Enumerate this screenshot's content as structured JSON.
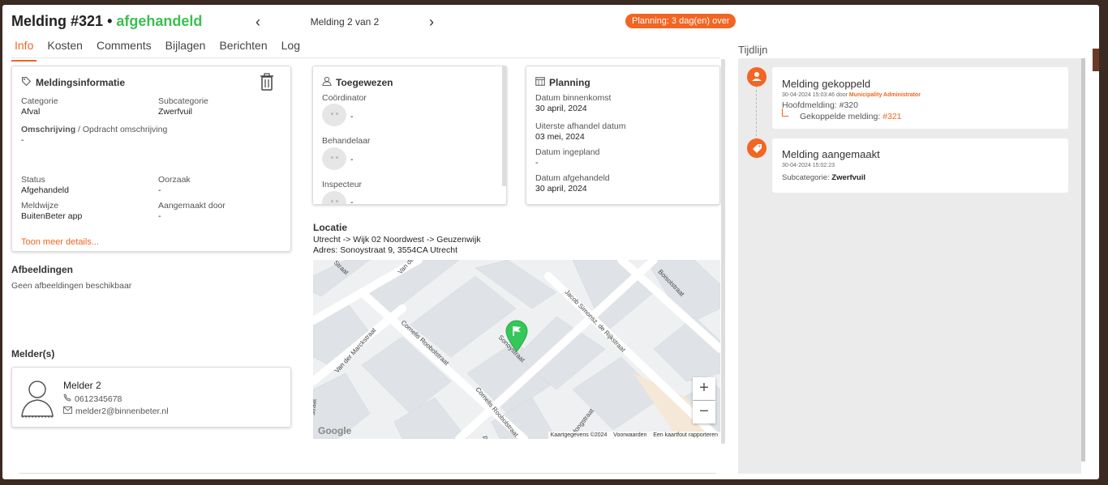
{
  "header": {
    "title": "Melding #321",
    "separator": "•",
    "status": "afgehandeld",
    "pager_label": "Melding 2 van 2",
    "planning_badge": "Planning: 3 dag(en) over"
  },
  "tabs": [
    {
      "label": "Info"
    },
    {
      "label": "Kosten"
    },
    {
      "label": "Comments"
    },
    {
      "label": "Bijlagen"
    },
    {
      "label": "Berichten"
    },
    {
      "label": "Log"
    }
  ],
  "info": {
    "title": "Meldingsinformatie",
    "categorie_label": "Categorie",
    "categorie_value": "Afval",
    "subcategorie_label": "Subcategorie",
    "subcategorie_value": "Zwerfvuil",
    "omschrijving_label": "Omschrijving",
    "omschrijving_suffix": " / Opdracht omschrijving",
    "omschrijving_value": "-",
    "status_label": "Status",
    "status_value": "Afgehandeld",
    "oorzaak_label": "Oorzaak",
    "oorzaak_value": "-",
    "meldwijze_label": "Meldwijze",
    "meldwijze_value": "BuitenBeter app",
    "aangemaakt_label": "Aangemaakt door",
    "aangemaakt_value": "-",
    "more_link": "Toon meer details..."
  },
  "afbeeldingen": {
    "title": "Afbeeldingen",
    "empty": "Geen afbeeldingen beschikbaar"
  },
  "melders": {
    "title": "Melder(s)",
    "name": "Melder 2",
    "phone": "0612345678",
    "email": "melder2@binnenbeter.nl"
  },
  "toegewezen": {
    "title": "Toegewezen",
    "coordinator_label": "Coördinator",
    "coordinator_value": "-",
    "behandelaar_label": "Behandelaar",
    "behandelaar_value": "-",
    "inspecteur_label": "Inspecteur",
    "inspecteur_value": "-"
  },
  "planning": {
    "title": "Planning",
    "binnenkomst_label": "Datum binnenkomst",
    "binnenkomst_value": "30 april, 2024",
    "uiterste_label": "Uiterste afhandel datum",
    "uiterste_value": "03 mei, 2024",
    "ingepland_label": "Datum ingepland",
    "ingepland_value": "-",
    "afgehandeld_label": "Datum afgehandeld",
    "afgehandeld_value": "30 april, 2024"
  },
  "locatie": {
    "title": "Locatie",
    "path": "Utrecht -> Wijk 02 Noordwest -> Geuzenwijk",
    "address": "Adres: Sonoystraat 9, 3554CA Utrecht"
  },
  "map": {
    "streets": [
      "Cornelis Roobolstraat",
      "Van der Marckstraat",
      "Jacob Simonsz. de Rijkstraat",
      "Boisotstraat",
      "Sonoystraat",
      "Cornelis Roobolstraat",
      "Van de",
      "Straat",
      "straat",
      "dongstraat",
      "plein"
    ],
    "zoom_in": "+",
    "zoom_out": "−",
    "google": "Google",
    "footer_data": "Kaartgegevens ©2024",
    "footer_terms": "Voorwaarden",
    "footer_report": "Een kaartfout rapporteren"
  },
  "tijdlijn": {
    "title": "Tijdlijn",
    "items": [
      {
        "heading": "Melding gekoppeld",
        "meta": "30-04-2024 15:03:46 door ",
        "user": "Municipality Administrator",
        "line1_label": "Hoofdmelding: ",
        "line1_value": "#320",
        "line2_label": "Gekoppelde melding: ",
        "line2_value": "#321"
      },
      {
        "heading": "Melding aangemaakt",
        "meta": "30-04-2024 15:02:23",
        "line1_label": "Subcategorie: ",
        "line1_value": "Zwerfvuil"
      }
    ]
  },
  "colors": {
    "accent": "#f26522",
    "success": "#3cbf4f",
    "marker": "#34c759"
  }
}
